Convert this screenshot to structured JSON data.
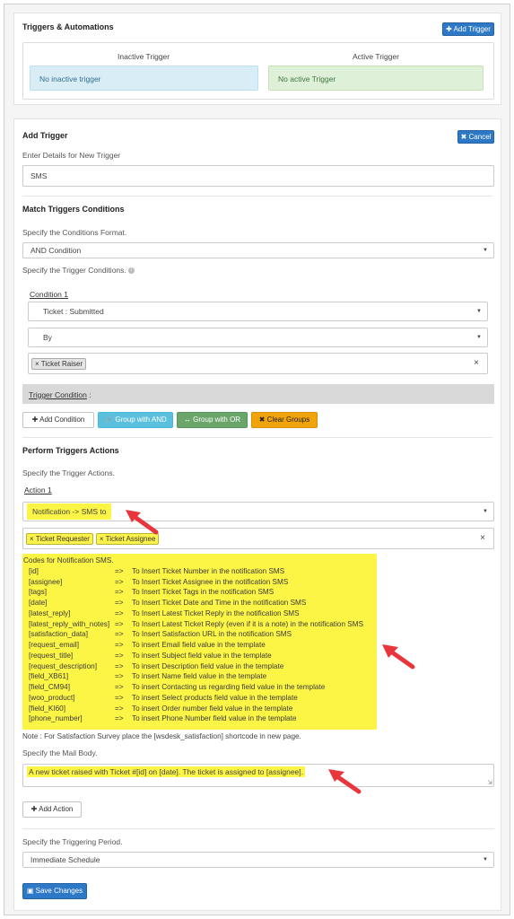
{
  "triggers": {
    "title": "Triggers & Automations",
    "add_button": "Add Trigger",
    "inactive_header": "Inactive Trigger",
    "active_header": "Active Trigger",
    "inactive_empty": "No inactive trigger",
    "active_empty": "No active Trigger"
  },
  "add_trigger": {
    "title": "Add Trigger",
    "cancel_button": "Cancel",
    "details_label": "Enter Details for New Trigger",
    "name_value": "SMS"
  },
  "conditions": {
    "title": "Match Triggers Conditions",
    "format_label": "Specify the Conditions Format.",
    "format_value": "AND Condition",
    "conditions_label": "Specify the Trigger Conditions.",
    "condition1_label": "Condition 1",
    "field_value": "Ticket : Submitted",
    "operator_value": "By",
    "tags": [
      "Ticket Raiser"
    ],
    "trigger_condition_label": "Trigger Condition",
    "trigger_condition_colon": ":",
    "buttons": {
      "add": "Add Condition",
      "group_and": "Group with AND",
      "group_or": "Group with OR",
      "clear": "Clear Groups"
    }
  },
  "actions": {
    "title": "Perform Triggers Actions",
    "specify_label": "Specify the Trigger Actions.",
    "action1_label": "Action 1",
    "action_value": "Notification -> SMS to",
    "tags": [
      "Ticket Requester",
      "Ticket Assignee"
    ],
    "codes_title": "Codes for Notification SMS.",
    "codes": [
      {
        "key": "[id]",
        "desc": "To Insert Ticket Number in the notification SMS"
      },
      {
        "key": "[assignee]",
        "desc": "To Insert Ticket Assignee in the notification SMS"
      },
      {
        "key": "[tags]",
        "desc": "To Insert Ticket Tags in the notification SMS"
      },
      {
        "key": "[date]",
        "desc": "To Insert Ticket Date and Time in the notification SMS"
      },
      {
        "key": "[latest_reply]",
        "desc": "To Insert Latest Ticket Reply in the notification SMS"
      },
      {
        "key": "[latest_reply_with_notes]",
        "desc": "To Insert Latest Ticket Reply (even if it is a note) in the notification SMS"
      },
      {
        "key": "[satisfaction_data]",
        "desc": "To Insert Satisfaction URL in the notification SMS"
      },
      {
        "key": "[request_email]",
        "desc": "To insert Email field value in the template"
      },
      {
        "key": "[request_title]",
        "desc": "To insert Subject field value in the template"
      },
      {
        "key": "[request_description]",
        "desc": "To insert Description field value in the template"
      },
      {
        "key": "[field_XB61]",
        "desc": "To insert Name field value in the template"
      },
      {
        "key": "[field_CM94]",
        "desc": "To insert Contacting us regarding field value in the template"
      },
      {
        "key": "[woo_product]",
        "desc": "To insert Select products field value in the template"
      },
      {
        "key": "[field_KI60]",
        "desc": "To insert Order number field value in the template"
      },
      {
        "key": "[phone_number]",
        "desc": "To insert Phone Number field value in the template"
      }
    ],
    "arrow_symbol": "=>",
    "note": "Note : For Satisfaction Survey place the [wsdesk_satisfaction] shortcode in new page.",
    "mail_body_label": "Specify the Mail Body.",
    "mail_body_value": "A new ticket raised with Ticket #[id] on [date]. The ticket is assigned to [assignee].",
    "add_action_button": "Add Action"
  },
  "period": {
    "label": "Specify the Triggering Period.",
    "value": "Immediate Schedule"
  },
  "save_button": "Save Changes",
  "colors": {
    "primary": "#2e78c8",
    "inactive_bg": "#d9edf7",
    "active_bg": "#dff0d8",
    "highlight": "#fcf545",
    "arrow": "#e8363c"
  }
}
